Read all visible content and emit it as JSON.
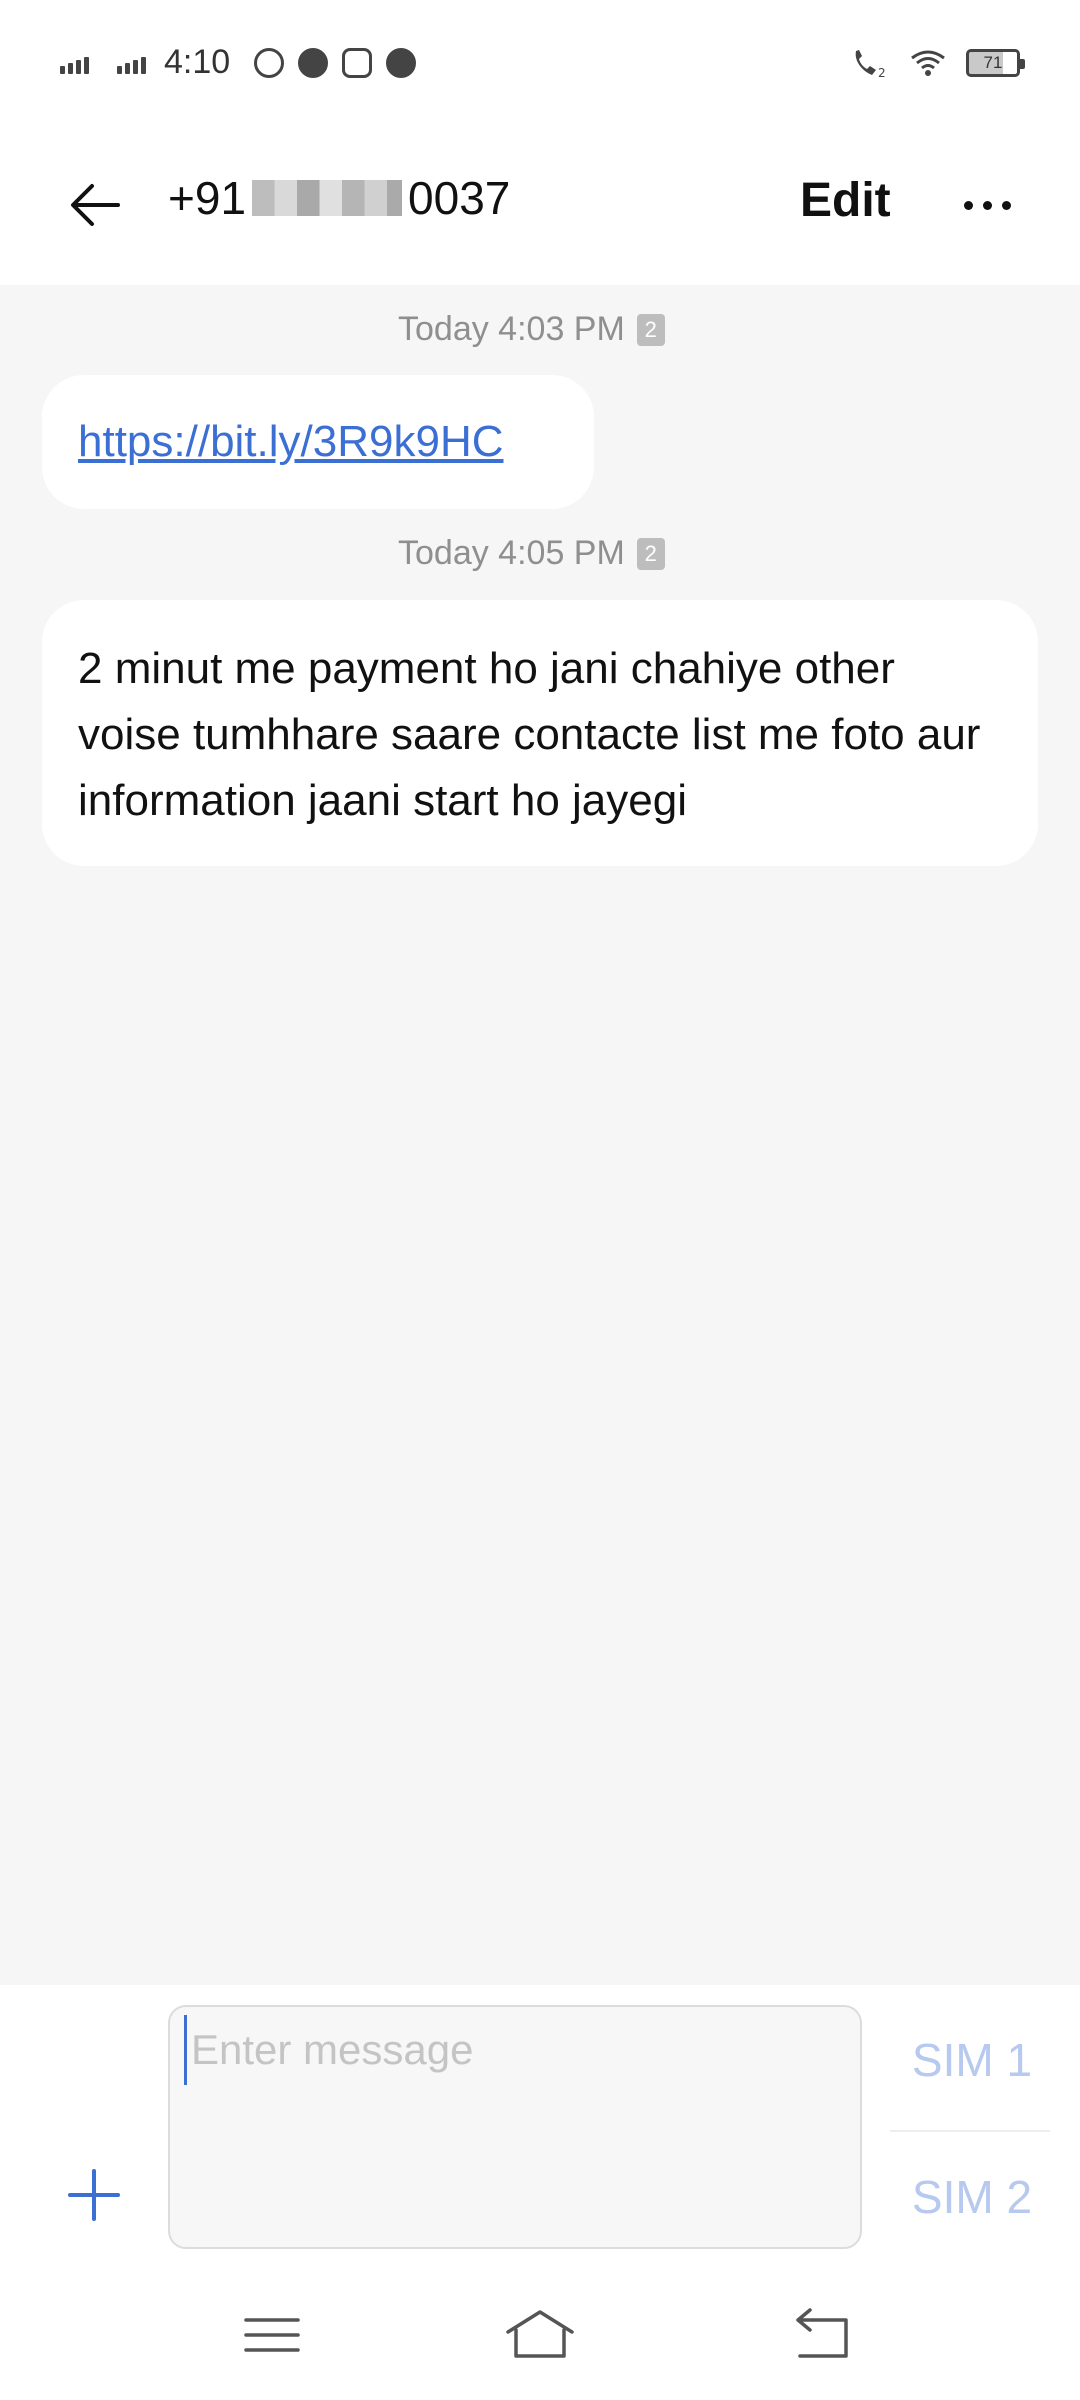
{
  "status_bar": {
    "time": "4:10",
    "battery": "71",
    "icons": [
      "signal-icon",
      "signal-icon",
      "whatsapp-icon",
      "snapchat-icon",
      "instagram-icon",
      "messenger-icon",
      "wifi-calling-icon",
      "wifi-icon",
      "battery-icon"
    ]
  },
  "header": {
    "contact_prefix": "+91",
    "contact_suffix": "0037",
    "edit_label": "Edit"
  },
  "messages": [
    {
      "timestamp": "Today 4:03 PM",
      "sim": "2",
      "text": "https://bit.ly/3R9k9HC",
      "is_link": true
    },
    {
      "timestamp": "Today 4:05 PM",
      "sim": "2",
      "text": "2 minut me payment ho jani chahiye other voise tumhhare saare contacte list me foto aur information jaani start ho jayegi",
      "is_link": false
    }
  ],
  "composer": {
    "placeholder": "Enter message",
    "sim1_label": "SIM 1",
    "sim2_label": "SIM 2"
  },
  "colors": {
    "accent": "#3b6fd4",
    "sim_button": "#b7c9ef",
    "background": "#f6f6f6"
  }
}
